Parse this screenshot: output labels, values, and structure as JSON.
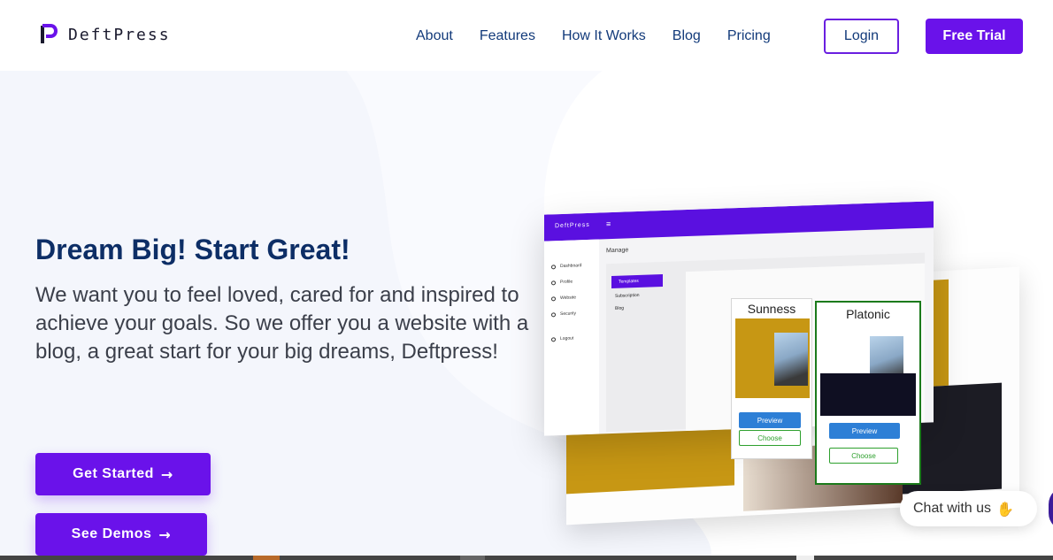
{
  "brand": {
    "name_part1": "Deft",
    "name_part2": "Press",
    "accent": "#6a12ea"
  },
  "nav": {
    "items": [
      {
        "label": "About"
      },
      {
        "label": "Features"
      },
      {
        "label": "How It Works"
      },
      {
        "label": "Blog"
      },
      {
        "label": "Pricing"
      }
    ],
    "login_label": "Login",
    "trial_label": "Free Trial"
  },
  "hero": {
    "title": "Dream Big! Start Great!",
    "subtitle": "We want you to feel loved, cared for and inspired to achieve your goals. So we offer you a website with a blog, a great start for your big dreams, Deftpress!",
    "get_started_label": "Get Started",
    "see_demos_label": "See Demos",
    "arrow_icon": "arrow-right-icon"
  },
  "mockup": {
    "brand": "DeftPress",
    "menu_icon": "hamburger-icon",
    "manage_label": "Manage",
    "sidebar": [
      "Dashboard",
      "Profile",
      "Website",
      "Security",
      "Logout"
    ],
    "tabs": [
      "Templates",
      "Subscription",
      "Blog"
    ],
    "templates": [
      {
        "name": "Sunness",
        "preview_label": "Preview",
        "choose_label": "Choose"
      },
      {
        "name": "Platonic",
        "preview_label": "Preview",
        "choose_label": "Choose"
      }
    ]
  },
  "chat": {
    "label": "Chat with us",
    "icon": "wave-hand-icon"
  }
}
